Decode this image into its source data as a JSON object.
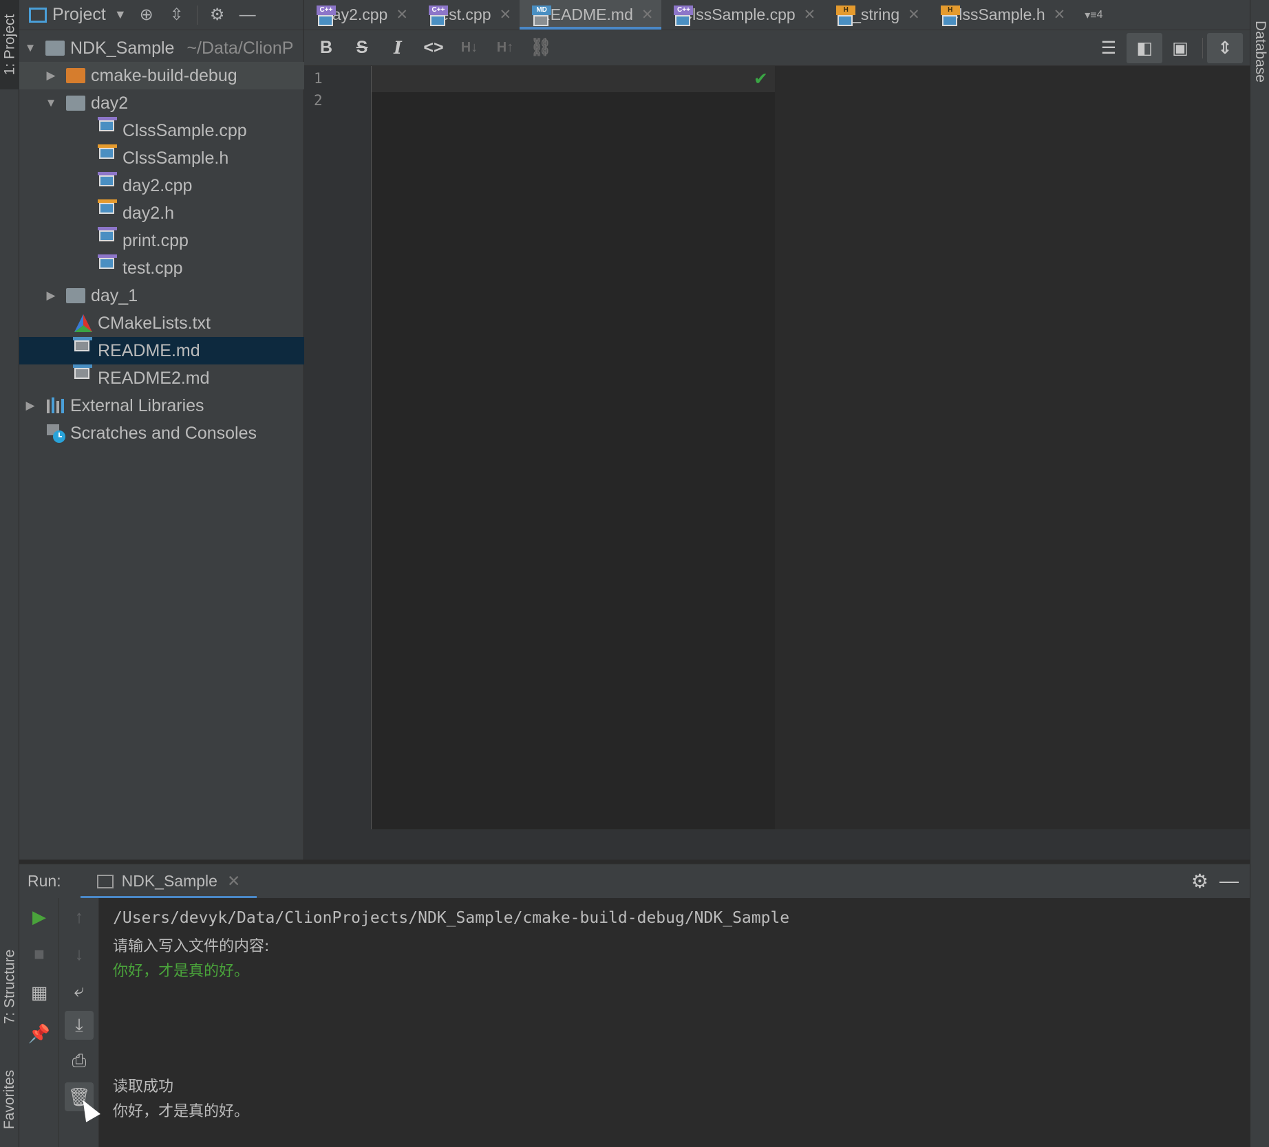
{
  "left_strip": {
    "project_tab": "1: Project",
    "structure_tab": "7: Structure",
    "favorites_tab": "Favorites"
  },
  "right_strip": {
    "database_tab": "Database"
  },
  "project_panel": {
    "title": "Project",
    "tree": [
      {
        "label": "NDK_Sample",
        "hint": "~/Data/ClionP",
        "icon": "folder-icon"
      },
      {
        "label": "cmake-build-debug",
        "icon": "folder-orange-icon"
      },
      {
        "label": "day2",
        "icon": "folder-icon"
      },
      {
        "label": "ClssSample.cpp",
        "icon": "cpp-file-icon"
      },
      {
        "label": "ClssSample.h",
        "icon": "header-file-icon"
      },
      {
        "label": "day2.cpp",
        "icon": "cpp-file-icon"
      },
      {
        "label": "day2.h",
        "icon": "header-file-icon"
      },
      {
        "label": "print.cpp",
        "icon": "cpp-file-icon"
      },
      {
        "label": "test.cpp",
        "icon": "cpp-file-icon"
      },
      {
        "label": "day_1",
        "icon": "folder-icon"
      },
      {
        "label": "CMakeLists.txt",
        "icon": "cmake-icon"
      },
      {
        "label": "README.md",
        "icon": "markdown-file-icon"
      },
      {
        "label": "README2.md",
        "icon": "markdown-file-icon"
      },
      {
        "label": "External Libraries",
        "icon": "library-icon"
      },
      {
        "label": "Scratches and Consoles",
        "icon": "scratches-icon"
      }
    ]
  },
  "tabs": [
    {
      "label": "day2.cpp",
      "type": "C++"
    },
    {
      "label": "test.cpp",
      "type": "C++"
    },
    {
      "label": "README.md",
      "type": "MD",
      "active": true
    },
    {
      "label": "ClssSample.cpp",
      "type": "C++"
    },
    {
      "label": "__string",
      "type": "H"
    },
    {
      "label": "ClssSample.h",
      "type": "H"
    }
  ],
  "tab_overflow": "4",
  "editor": {
    "line_numbers": [
      "1",
      "2"
    ]
  },
  "run": {
    "label": "Run:",
    "tab": "NDK_Sample",
    "console": [
      "/Users/devyk/Data/ClionProjects/NDK_Sample/cmake-build-debug/NDK_Sample",
      "请输入写入文件的内容:",
      "你好，才是真的好。",
      "读取成功",
      "你好，才是真的好。"
    ]
  },
  "colors": {
    "accent": "#4a88c7",
    "selection": "#0d293e",
    "input_text": "#4aa33b",
    "check": "#3aa544"
  }
}
